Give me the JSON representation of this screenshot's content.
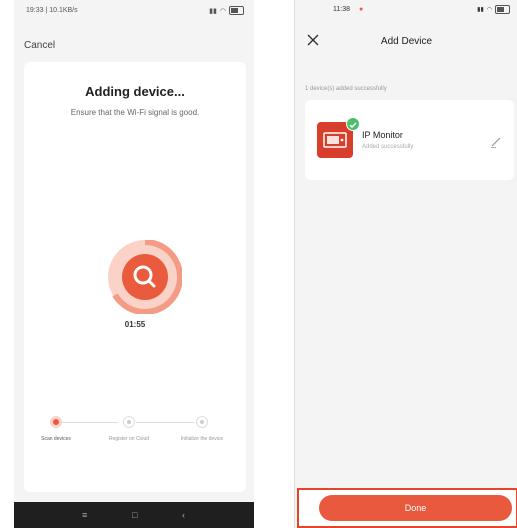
{
  "left": {
    "status_time": "19:33 | 10.1KB/s",
    "cancel_label": "Cancel",
    "title": "Adding device...",
    "subtitle": "Ensure that the Wi-Fi signal is good.",
    "timer": "01:55",
    "steps": [
      {
        "label": "Scan devices",
        "state": "active"
      },
      {
        "label": "Register on Cloud",
        "state": "pending"
      },
      {
        "label": "Initialize the device",
        "state": "pending"
      }
    ],
    "icons": {
      "search": "search-icon"
    }
  },
  "right": {
    "status_time": "11:38",
    "title": "Add Device",
    "added_count": "1 device(s) added successfully",
    "device": {
      "name": "IP Monitor",
      "status": "Added successfully"
    },
    "done_label": "Done"
  },
  "colors": {
    "accent": "#e8593d",
    "success": "#4cbf6b",
    "device_red": "#d93e2a"
  }
}
